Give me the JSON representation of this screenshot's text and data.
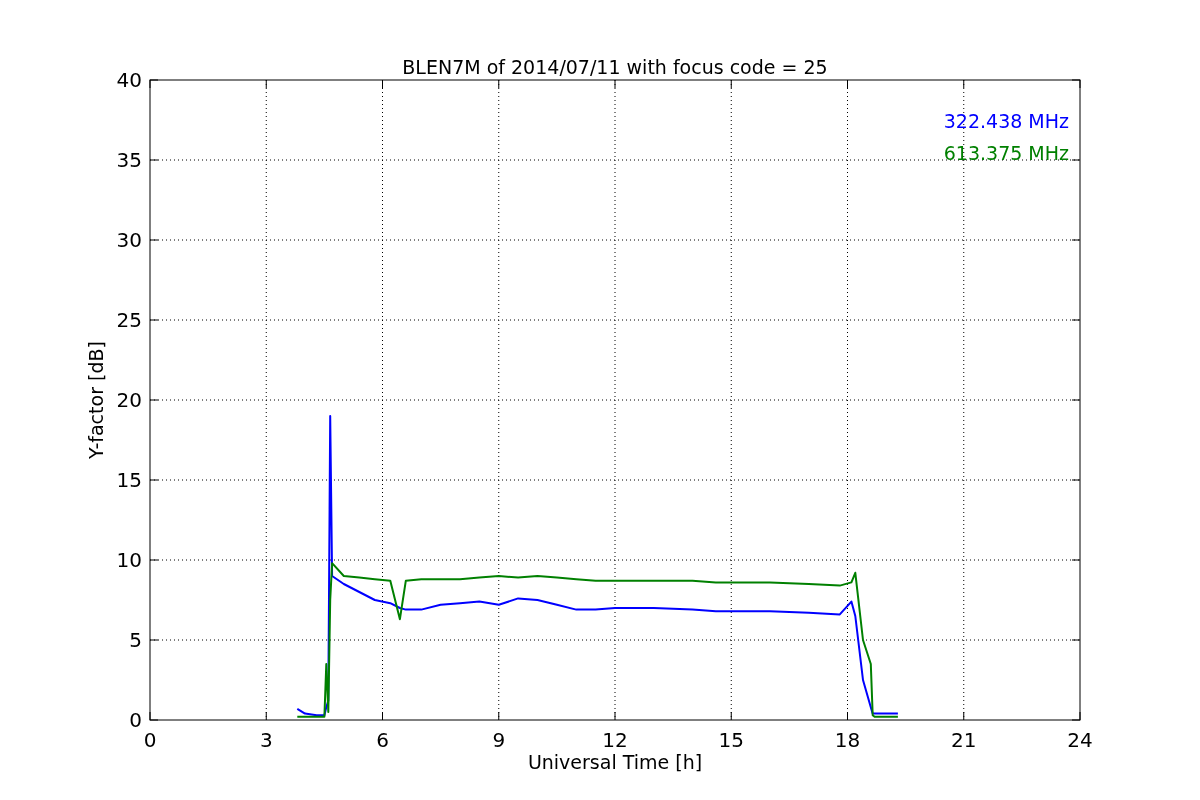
{
  "chart_data": {
    "type": "line",
    "title": "BLEN7M of 2014/07/11 with focus code = 25",
    "xlabel": "Universal Time [h]",
    "ylabel": "Y-factor [dB]",
    "x": [
      3.8,
      4.0,
      4.3,
      4.5,
      4.55,
      4.6,
      4.65,
      4.7,
      5.0,
      5.4,
      5.8,
      6.2,
      6.45,
      6.6,
      7.0,
      7.5,
      8.0,
      8.5,
      9.0,
      9.5,
      10.0,
      10.5,
      11.0,
      11.5,
      12.0,
      13.0,
      14.0,
      14.6,
      15.0,
      16.0,
      17.0,
      17.8,
      18.1,
      18.2,
      18.4,
      18.6,
      18.65,
      18.7,
      19.0,
      19.3
    ],
    "series": [
      {
        "name": "322.438 MHz",
        "color": "#0000ff",
        "values": [
          0.7,
          0.4,
          0.3,
          0.3,
          0.8,
          1.2,
          19.0,
          9.0,
          8.5,
          8.0,
          7.5,
          7.3,
          7.0,
          6.9,
          6.9,
          7.2,
          7.3,
          7.4,
          7.2,
          7.6,
          7.5,
          7.2,
          6.9,
          6.9,
          7.0,
          7.0,
          6.9,
          6.8,
          6.8,
          6.8,
          6.7,
          6.6,
          7.4,
          6.5,
          2.5,
          0.8,
          0.4,
          0.4,
          0.4,
          0.4
        ]
      },
      {
        "name": "613.375 MHz",
        "color": "#008000",
        "values": [
          0.2,
          0.2,
          0.2,
          0.2,
          3.5,
          0.5,
          7.5,
          9.8,
          9.0,
          8.9,
          8.8,
          8.7,
          6.3,
          8.7,
          8.8,
          8.8,
          8.8,
          8.9,
          9.0,
          8.9,
          9.0,
          8.9,
          8.8,
          8.7,
          8.7,
          8.7,
          8.7,
          8.6,
          8.6,
          8.6,
          8.5,
          8.4,
          8.6,
          9.2,
          5.0,
          3.5,
          0.3,
          0.2,
          0.2,
          0.2
        ]
      }
    ],
    "grid": true,
    "xlim": [
      0,
      24
    ],
    "ylim": [
      0,
      40
    ],
    "xticks": [
      0,
      3,
      6,
      9,
      12,
      15,
      18,
      21,
      24
    ],
    "yticks": [
      0,
      5,
      10,
      15,
      20,
      25,
      30,
      35,
      40
    ]
  }
}
